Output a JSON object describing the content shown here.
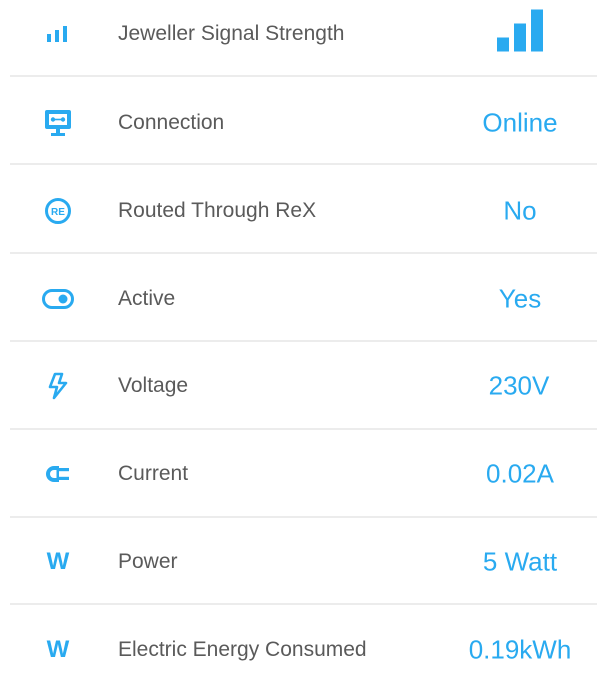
{
  "accent_color": "#29aaf0",
  "rows": [
    {
      "icon": "signal-bars-icon",
      "label": "Jeweller Signal Strength",
      "value": "",
      "signal_level": 3,
      "signal_max": 3
    },
    {
      "icon": "connection-monitor-icon",
      "label": "Connection",
      "value": "Online"
    },
    {
      "icon": "rex-badge-icon",
      "label": "Routed Through ReX",
      "value": "No",
      "icon_text": "RE"
    },
    {
      "icon": "toggle-switch-icon",
      "label": "Active",
      "value": "Yes"
    },
    {
      "icon": "lightning-bolt-icon",
      "label": "Voltage",
      "value": "230V"
    },
    {
      "icon": "plug-icon",
      "label": "Current",
      "value": "0.02A"
    },
    {
      "icon": "power-w-icon",
      "label": "Power",
      "value": "5 Watt",
      "icon_text": "W"
    },
    {
      "icon": "energy-w-icon",
      "label": "Electric Energy Consumed",
      "value": "0.19kWh",
      "icon_text": "W"
    }
  ]
}
